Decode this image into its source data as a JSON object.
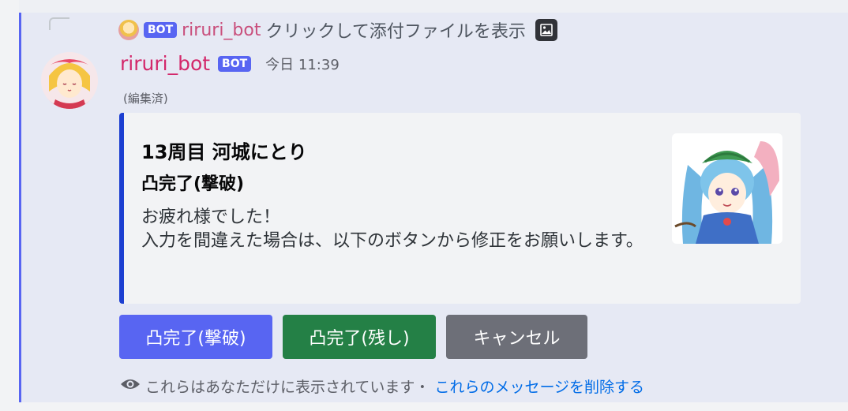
{
  "reply": {
    "badge": "BOT",
    "username": "riruri_bot",
    "text": "クリックして添付ファイルを表示"
  },
  "message": {
    "author": "riruri_bot",
    "badge": "BOT",
    "timestamp": "今日 11:39",
    "edited": "(編集済)"
  },
  "embed": {
    "title": "13周目 河城にとり",
    "subtitle": "凸完了(撃破)",
    "description": "お疲れ様でした！\n入力を間違えた場合は、以下のボタンから修正をお願いします。",
    "accent_color": "#1c3fd1"
  },
  "buttons": [
    {
      "label": "凸完了(撃破)",
      "style": "primary",
      "color": "#5865f2"
    },
    {
      "label": "凸完了(残し)",
      "style": "success",
      "color": "#248046"
    },
    {
      "label": "キャンセル",
      "style": "secondary",
      "color": "#6d6f78"
    }
  ],
  "footer": {
    "text": "これらはあなただけに表示されています・",
    "link": "これらのメッセージを削除する"
  },
  "icons": {
    "reply_attachment": "image-icon",
    "footer_visibility": "eye-icon"
  }
}
